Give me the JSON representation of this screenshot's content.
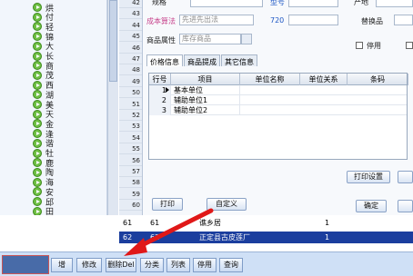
{
  "tree": {
    "items": [
      "烘",
      "付",
      "轻",
      "锦",
      "大",
      "长",
      "商",
      "茂",
      "西",
      "湖",
      "美",
      "天",
      "金",
      "逢",
      "谐",
      "牡",
      "鹿",
      "陶",
      "海",
      "安",
      "邱",
      "田"
    ]
  },
  "rownums": [
    "42",
    "43",
    "44",
    "45",
    "46",
    "47",
    "48",
    "49",
    "50",
    "51",
    "52",
    "53",
    "54",
    "55",
    "56",
    "57",
    "58",
    "59",
    "60"
  ],
  "form": {
    "spec_label": "规格",
    "model_label": "型号",
    "place_label": "产地",
    "cost_label": "成本算法",
    "cost_value": "先进先出法",
    "code_partial": "720",
    "replace_label": "替换品",
    "attr_label": "商品属性",
    "attr_value": "库存商品",
    "disable_label": "停用",
    "tabs": [
      "价格信息",
      "商品提成",
      "其它信息"
    ],
    "grid": {
      "headers": [
        "行号",
        "项目",
        "单位名称",
        "单位关系",
        "条码"
      ],
      "rows": [
        {
          "num": "1",
          "item": "基本单位"
        },
        {
          "num": "2",
          "item": "辅助单位1"
        },
        {
          "num": "3",
          "item": "辅助单位2"
        }
      ]
    },
    "print_settings": "打印设置",
    "print": "打印",
    "custom": "自定义",
    "ok": "确定"
  },
  "list": {
    "rows": [
      {
        "num": "61",
        "code": "61",
        "name": "谯乡居",
        "qty": "1"
      },
      {
        "num": "62",
        "code": "62",
        "name": "正定县古皮莲厂",
        "qty": "1"
      }
    ]
  },
  "toolbar": {
    "add": "增",
    "edit": "修改",
    "delete": "删除Del",
    "category": "分类",
    "listview": "列表",
    "disable": "停用",
    "query": "查询"
  },
  "colors": {
    "selected_row": "#1b3e9e",
    "arrow": "#e01818",
    "toolbar_bg": "#cfe0f6"
  }
}
